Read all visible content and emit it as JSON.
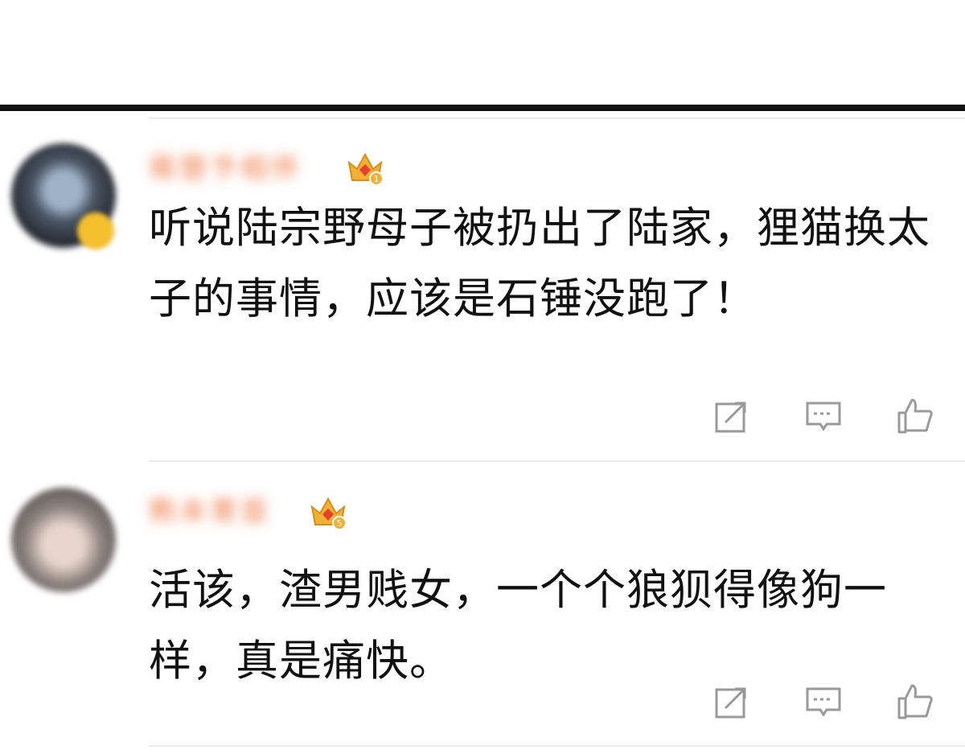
{
  "comments": [
    {
      "username": "蒋楚予相伴",
      "crown_level": "1",
      "text": "听说陆宗野母子被扔出了陆家，狸猫换太子的事情，应该是石锤没跑了！"
    },
    {
      "username": "熟本青苗",
      "crown_level": "5",
      "text": "活该，渣男贱女，一个个狼狈得像狗一样，真是痛快。"
    }
  ],
  "colors": {
    "crown_gold": "#f2b136",
    "crown_red": "#e2422e",
    "icon_gray": "#9a9a9a"
  },
  "icons": [
    "share-icon",
    "comment-icon",
    "like-icon"
  ]
}
